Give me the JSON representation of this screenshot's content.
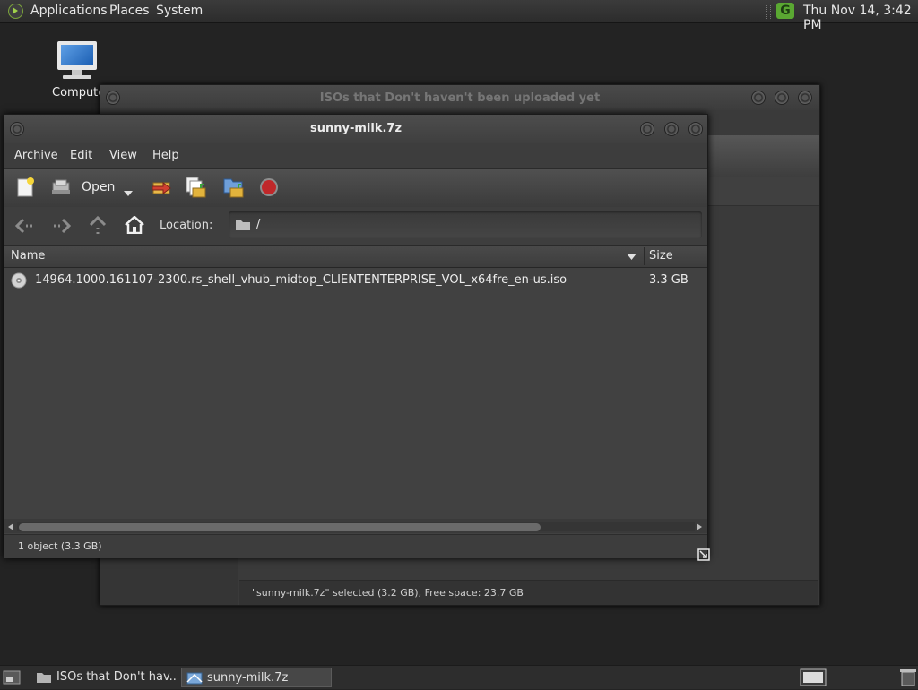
{
  "top_panel": {
    "menus": [
      "Applications",
      "Places",
      "System"
    ],
    "clock": "Thu Nov 14,  3:42 PM",
    "update_icon_label": "G"
  },
  "desktop": {
    "icons": [
      {
        "label": "Computer",
        "icon": "computer-icon"
      }
    ]
  },
  "back_window": {
    "title": "ISOs that Don't haven't been uploaded yet",
    "status": "\"sunny-milk.7z\" selected (3.2 GB), Free space: 23.7 GB"
  },
  "archive_window": {
    "title": "sunny-milk.7z",
    "menu": [
      "Archive",
      "Edit",
      "View",
      "Help"
    ],
    "toolbar": {
      "open_label": "Open",
      "buttons": [
        "new-archive-icon",
        "open-archive-icon",
        "open-dropdown-icon",
        "extract-icon",
        "add-files-icon",
        "add-folder-icon",
        "stop-icon"
      ]
    },
    "location": {
      "label": "Location:",
      "path": "/"
    },
    "columns": {
      "name": "Name",
      "size": "Size"
    },
    "files": [
      {
        "name": "14964.1000.161107-2300.rs_shell_vhub_midtop_CLIENTENTERPRISE_VOL_x64fre_en-us.iso",
        "size": "3.3 GB",
        "icon": "disc-image-icon"
      }
    ],
    "status": "1 object (3.3 GB)"
  },
  "taskbar": {
    "tasks": [
      {
        "label": "ISOs that Don't hav...",
        "icon": "folder-icon",
        "active": false
      },
      {
        "label": "sunny-milk.7z",
        "icon": "archive-manager-icon",
        "active": true
      }
    ]
  },
  "colors": {
    "accent_green": "#5aa832",
    "stop_red": "#c0282a",
    "folder_yellow": "#e2b33c"
  }
}
